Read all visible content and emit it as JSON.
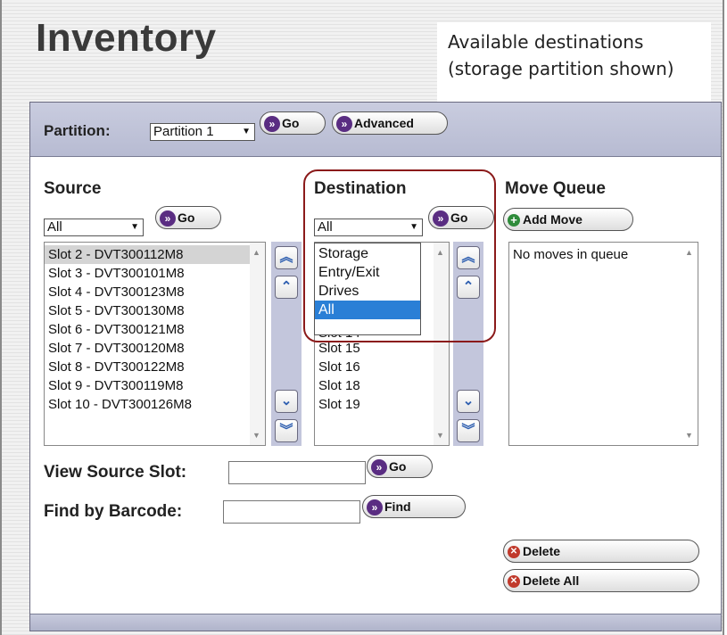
{
  "page": {
    "title": "Inventory"
  },
  "callout": {
    "line1": "Available destinations",
    "line2": "(storage partition shown)"
  },
  "partition": {
    "label": "Partition:",
    "selected": "Partition 1",
    "go_label": "Go",
    "advanced_label": "Advanced"
  },
  "source": {
    "label": "Source",
    "filter": "All",
    "go_label": "Go",
    "items": [
      "Slot 2 - DVT300112M8",
      "Slot 3 - DVT300101M8",
      "Slot 4 - DVT300123M8",
      "Slot 5 - DVT300130M8",
      "Slot 6 - DVT300121M8",
      "Slot 7 - DVT300120M8",
      "Slot 8 - DVT300122M8",
      "Slot 9 - DVT300119M8",
      "Slot 10 - DVT300126M8"
    ]
  },
  "destination": {
    "label": "Destination",
    "filter": "All",
    "go_label": "Go",
    "dropdown_options": [
      "Storage",
      "Entry/Exit",
      "Drives",
      "All"
    ],
    "selected_option": "All",
    "partial_item": "Slot 14",
    "items": [
      "Slot 15",
      "Slot 16",
      "Slot 18",
      "Slot 19"
    ]
  },
  "move_queue": {
    "label": "Move Queue",
    "add_move_label": "Add Move",
    "empty_text": "No moves in queue"
  },
  "view_source_slot": {
    "label": "View Source Slot:",
    "value": "",
    "go_label": "Go"
  },
  "find_by_barcode": {
    "label": "Find by Barcode:",
    "value": "",
    "find_label": "Find"
  },
  "actions": {
    "delete_label": "Delete",
    "delete_all_label": "Delete All"
  },
  "icons": {
    "go": "double-chevron-right-icon",
    "add": "plus-circle-icon",
    "delete": "x-circle-icon",
    "move_first": "double-chevron-up-icon",
    "move_up": "chevron-up-icon",
    "move_down": "chevron-down-icon",
    "move_last": "double-chevron-down-icon"
  },
  "colors": {
    "highlight": "#8b1a1a",
    "selection": "#2a7fd6",
    "go_icon": "#5a2d82",
    "panel_bar": "#c0c3d9"
  }
}
